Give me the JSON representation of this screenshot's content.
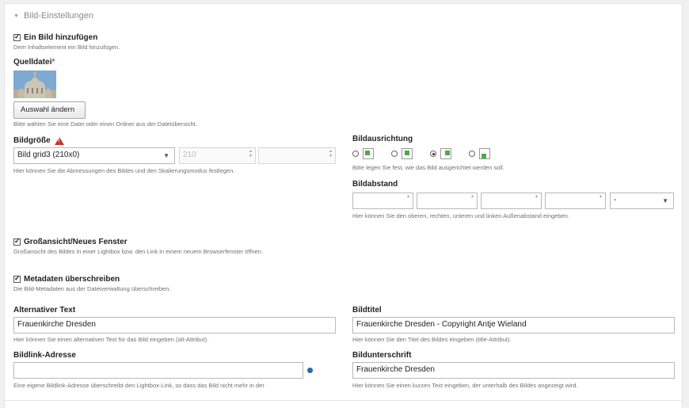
{
  "section": {
    "title": "Bild-Einstellungen"
  },
  "add_image": {
    "label": "Ein Bild hinzufügen",
    "help": "Dem Inhaltselement ein Bild hinzufügen.",
    "checked": true
  },
  "source": {
    "label": "Quelldatei",
    "required": "*",
    "button": "Auswahl ändern",
    "help": "Bitte wählen Sie eine Datei oder einen Ordner aus der Dateiübersicht.",
    "image_alt": "Frauenkirche Dresden"
  },
  "size": {
    "label": "Bildgröße",
    "selected": "Bild grid3 (210x0)",
    "width": "210",
    "height": "",
    "help": "Hier können Sie die Abmessungen des Bildes und den Skalierungsmodus festlegen."
  },
  "alignment": {
    "label": "Bildausrichtung",
    "options": [
      "left",
      "center",
      "right",
      "below"
    ],
    "selected_index": 2,
    "help": "Bitte legen Sie fest, wie das Bild ausgerichtet werden soll."
  },
  "margin": {
    "label": "Bildabstand",
    "values": [
      "",
      "",
      "",
      ""
    ],
    "unit": "-",
    "help": "Hier können Sie den oberen, rechten, unteren und linken Außenabstand eingeben."
  },
  "fullsize": {
    "label": "Großansicht/Neues Fenster",
    "help": "Großansicht des Bildes in einer Lightbox bzw. den Link in einem neuem Browserfenster öffnen.",
    "checked": true
  },
  "metadata": {
    "label": "Metadaten überschreiben",
    "help": "Die Bild-Metadaten aus der Dateiverwaltung überschreiben.",
    "checked": true
  },
  "alt": {
    "label": "Alternativer Text",
    "value": "Frauenkirche Dresden",
    "help": "Hier können Sie einen alternativen Text für das Bild eingeben (alt-Attribut)."
  },
  "title": {
    "label": "Bildtitel",
    "value": "Frauenkirche Dresden - Copyright Antje Wieland",
    "help": "Hier können Sie den Titel des Bildes eingeben (title-Attribut)."
  },
  "link": {
    "label": "Bildlink-Adresse",
    "value": "",
    "help": "Eine eigene Bildlink-Adresse überschreibt den Lightbox-Link, so dass das Bild nicht mehr in der"
  },
  "caption": {
    "label": "Bildunterschrift",
    "value": "Frauenkirche Dresden",
    "help": "Hier können Sie einen kurzen Text eingeben, der unterhalb des Bildes angezeigt wird."
  }
}
